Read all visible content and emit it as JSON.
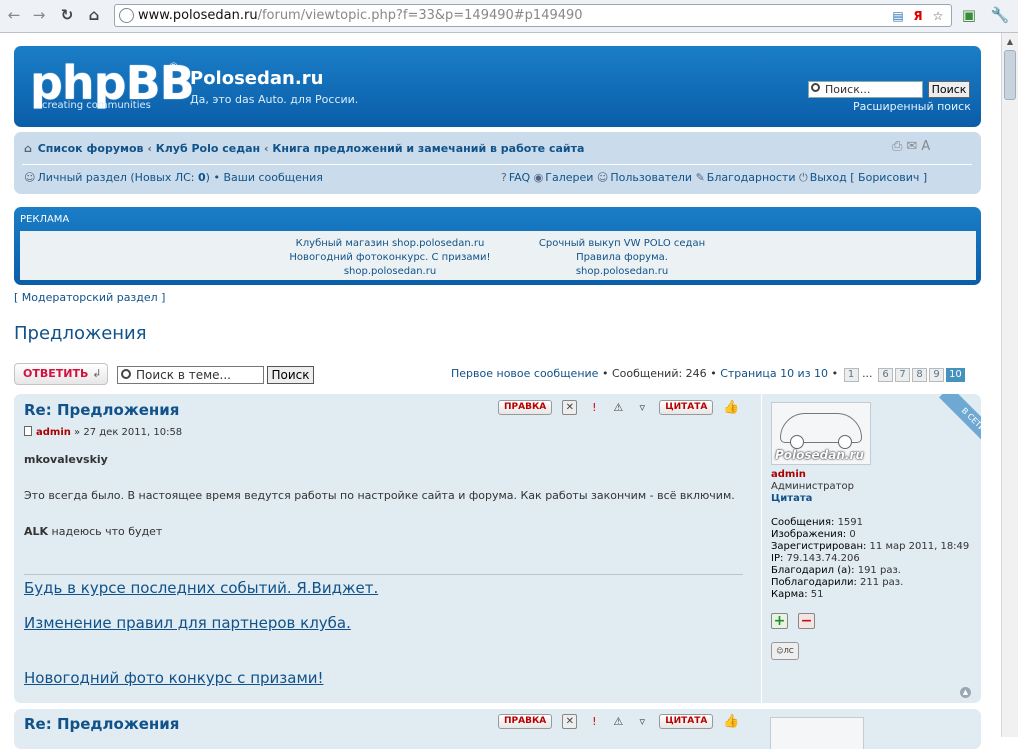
{
  "browser": {
    "url_host": "www.polosedan.ru",
    "url_path": "/forum/viewtopic.php?f=33&p=149490#p149490"
  },
  "header": {
    "logo_text": "phpBB",
    "logo_reg": "®",
    "logo_tagline": "creating  communities",
    "site_title": "Polosedan.ru",
    "site_desc": "Да, это das Auto. для России.",
    "search_placeholder": "Поиск...",
    "search_button": "Поиск",
    "advanced_search": "Расширенный поиск"
  },
  "navbar": {
    "crumbs": [
      "Список форумов",
      "Клуб Polo седан",
      "Книга предложений и замечаний в работе сайта"
    ],
    "crumb_sep": "‹",
    "private_section": "Личный раздел (Новых ЛС: ",
    "new_pm_count": "0",
    "private_close": ")",
    "bullet": "•",
    "your_posts": "Ваши сообщения",
    "faq": "FAQ",
    "galleries": "Галереи",
    "users": "Пользователи",
    "thanks": "Благодарности",
    "logout": "Выход [ Борисович ]",
    "font_size": "A"
  },
  "ad": {
    "title": "РЕКЛАМА",
    "col1": [
      "Клубный магазин shop.polosedan.ru",
      "Новогодний фотоконкурс. С призами!",
      "shop.polosedan.ru"
    ],
    "col2": [
      "Срочный выкуп VW POLO седан",
      "Правила форума.",
      "shop.polosedan.ru"
    ]
  },
  "moderator_link": "[ Модераторский раздел ]",
  "page_title": "Предложения",
  "actions": {
    "reply_button": "ОТВЕТИТЬ",
    "topic_search_placeholder": "Поиск в теме...",
    "topic_search_button": "Поиск",
    "first_new": "Первое новое сообщение",
    "posts_count": "Сообщений: 246",
    "page_of": "Страница 10 из 10",
    "pages": [
      "1",
      "6",
      "7",
      "8",
      "9",
      "10"
    ],
    "ellipsis": "..."
  },
  "post": {
    "re": "Re",
    "title": ": Предложения",
    "author": "admin",
    "date": " » 27 дек 2011, 10:58",
    "buttons": {
      "edit": "ПРАВКА",
      "quote": "ЦИТАТА"
    },
    "body": {
      "addressee": "mkovalevskiy",
      "p1": "Это всегда было. В настоящее время ведутся работы по настройке сайта и форума. Как работы закончим - всё включим.",
      "alk": "ALK",
      "p2": " надеюсь что будет"
    },
    "signature": [
      "Будь в курсе последних событий. Я.Виджет.",
      "Изменение правил для партнеров клуба.",
      "Новогодний фото конкурс с призами!"
    ],
    "profile": {
      "online": "В СЕТИ",
      "avatar_text": "Polosedan.ru",
      "name": "admin",
      "rank": "Администратор",
      "quote": "Цитата",
      "stats": [
        {
          "label": "Сообщения: ",
          "value": "1591"
        },
        {
          "label": "Изображения: ",
          "value": "0"
        },
        {
          "label": "Зарегистрирован: ",
          "value": "11 мар 2011, 18:49"
        },
        {
          "label": "IP: ",
          "value": "79.143.74.206"
        },
        {
          "label": "Благодарил (а): ",
          "value": "191 раз."
        },
        {
          "label": "Поблагодарили: ",
          "value": "211 раз."
        },
        {
          "label": "Карма: ",
          "value": "51"
        }
      ],
      "pm_label": "ЛС"
    }
  },
  "post2": {
    "re": "Re",
    "title": ": Предложения",
    "buttons": {
      "edit": "ПРАВКА",
      "quote": "ЦИТАТА"
    }
  }
}
